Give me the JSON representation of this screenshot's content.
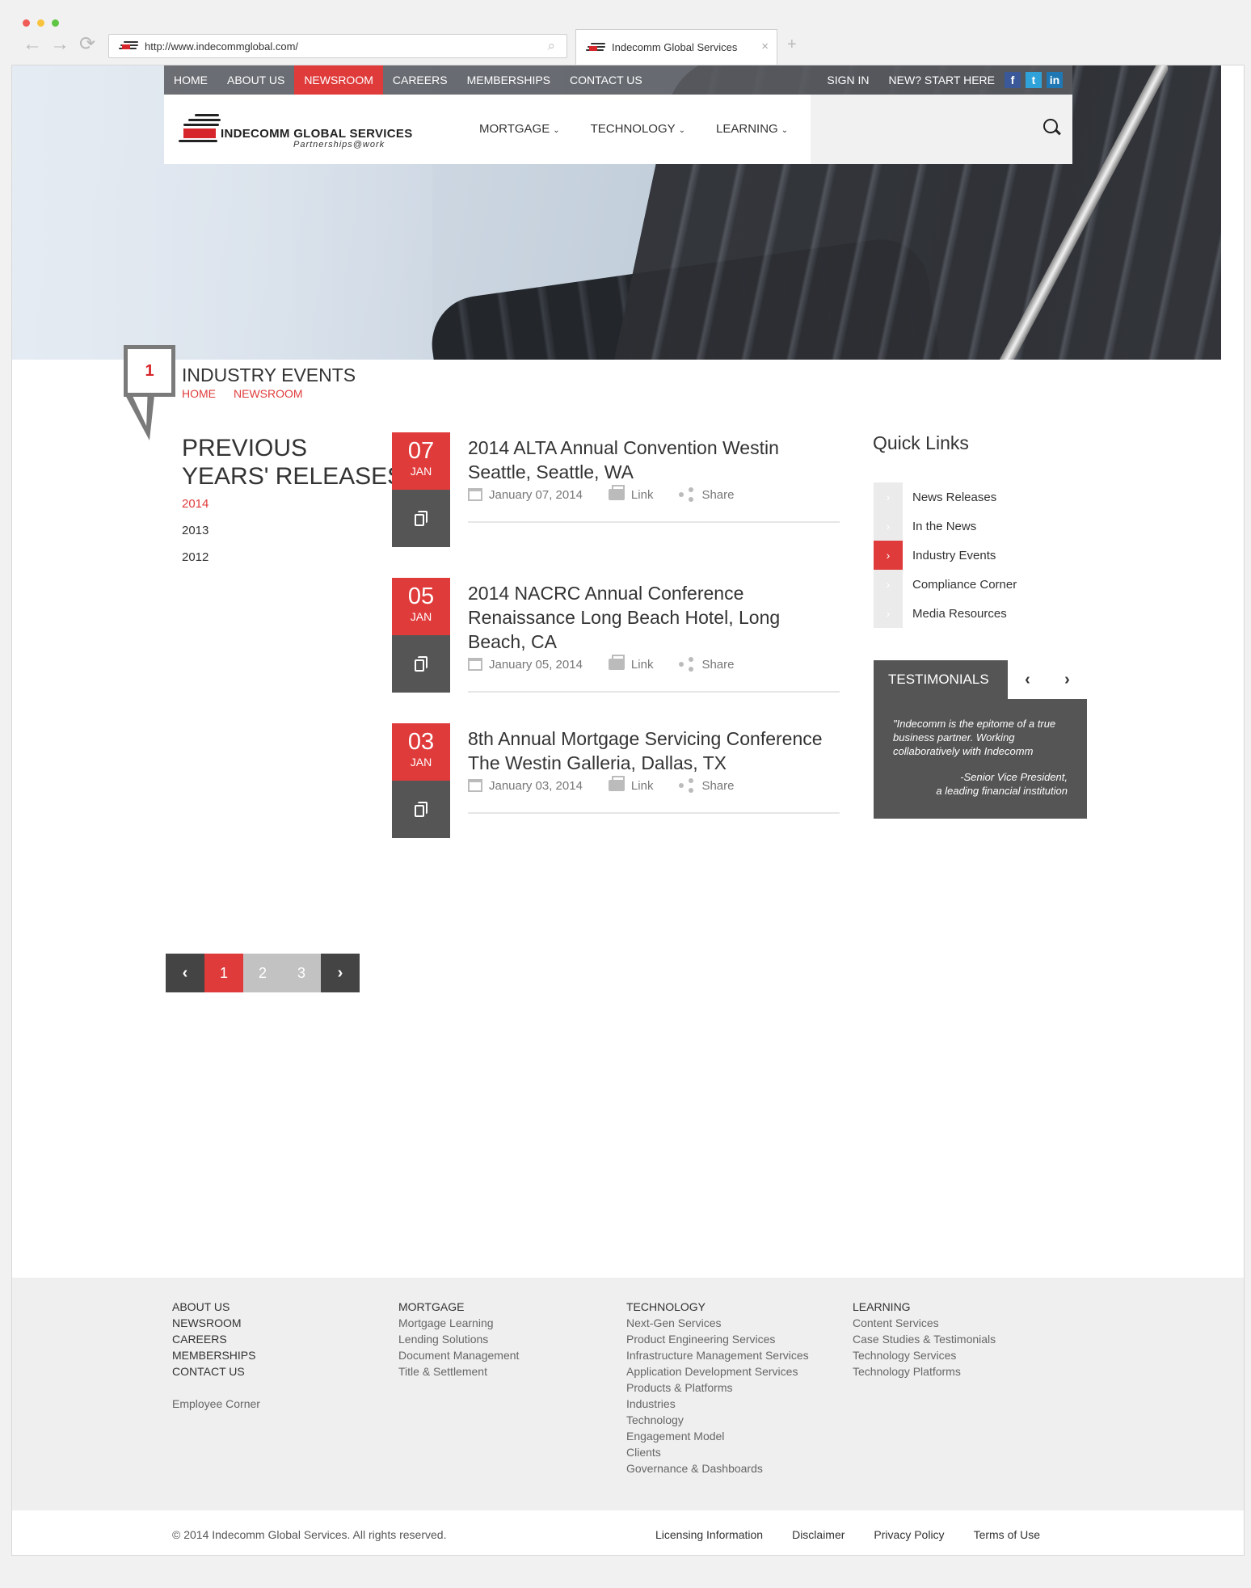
{
  "browser": {
    "url": "http://www.indecommglobal.com/",
    "tab_title": "Indecomm Global Services",
    "tab_close": "×",
    "new_tab": "+"
  },
  "topnav": {
    "items": [
      "HOME",
      "ABOUT US",
      "NEWSROOM",
      "CAREERS",
      "MEMBERSHIPS",
      "CONTACT US"
    ],
    "active": "NEWSROOM",
    "sign_in": "SIGN IN",
    "start_here": "NEW? START HERE",
    "social": [
      "f",
      "t",
      "in"
    ]
  },
  "brand": {
    "name": "INDECOMM GLOBAL SERVICES",
    "tagline": "Partnerships@work"
  },
  "mainnav": {
    "menus": [
      "MORTGAGE",
      "TECHNOLOGY",
      "LEARNING"
    ]
  },
  "page": {
    "callout_number": "1",
    "title": "INDUSTRY EVENTS",
    "breadcrumb": [
      "HOME",
      "NEWSROOM"
    ]
  },
  "sidebar": {
    "heading_line1": "PREVIOUS",
    "heading_line2": "YEARS' RELEASES",
    "years": [
      "2014",
      "2013",
      "2012"
    ],
    "selected_year": "2014"
  },
  "events": [
    {
      "day": "07",
      "month": "JAN",
      "title": "2014 ALTA Annual Convention Westin Seattle, Seattle, WA",
      "date": "January 07, 2014",
      "link": "Link",
      "share": "Share"
    },
    {
      "day": "05",
      "month": "JAN",
      "title": "2014 NACRC Annual Conference Renaissance Long Beach Hotel, Long Beach, CA",
      "date": "January 05, 2014",
      "link": "Link",
      "share": "Share"
    },
    {
      "day": "03",
      "month": "JAN",
      "title": "8th Annual Mortgage Servicing Conference The Westin Galleria, Dallas, TX",
      "date": "January 03, 2014",
      "link": "Link",
      "share": "Share"
    }
  ],
  "quick_links": {
    "title": "Quick Links",
    "items": [
      "News Releases",
      "In the News",
      "Industry Events",
      "Compliance Corner",
      "Media Resources"
    ],
    "active": "Industry Events"
  },
  "testimonials": {
    "heading": "TESTIMONIALS",
    "quote": "\"Indecomm is the epitome of a true business partner. Working collaboratively with Indecomm",
    "author_line1": "-Senior Vice President,",
    "author_line2": "a leading financial institution"
  },
  "pagination": {
    "prev": "‹",
    "pages": [
      "1",
      "2",
      "3"
    ],
    "current": "1",
    "next": "›"
  },
  "footer": {
    "col1": [
      "ABOUT US",
      "NEWSROOM",
      "CAREERS",
      "MEMBERSHIPS",
      "CONTACT US"
    ],
    "col1_extra": "Employee Corner",
    "col2_heading": "MORTGAGE",
    "col2": [
      "Mortgage Learning",
      "Lending Solutions",
      "Document Management",
      "Title & Settlement"
    ],
    "col3_heading": "TECHNOLOGY",
    "col3": [
      "Next-Gen Services",
      "Product Engineering Services",
      "Infrastructure Management Services",
      "Application Development Services",
      "Products & Platforms",
      "Industries",
      "Technology",
      "Engagement Model",
      "Clients",
      "Governance & Dashboards"
    ],
    "col4_heading": "LEARNING",
    "col4": [
      "Content Services",
      "Case Studies & Testimonials",
      "Technology Services",
      "Technology Platforms"
    ],
    "copyright": "© 2014 Indecomm Global Services. All rights reserved.",
    "legal": [
      "Licensing Information",
      "Disclaimer",
      "Privacy Policy",
      "Terms of Use"
    ]
  },
  "colors": {
    "accent": "#e03b3b",
    "dark": "#555555",
    "nav_bg": "#5a5c62"
  }
}
